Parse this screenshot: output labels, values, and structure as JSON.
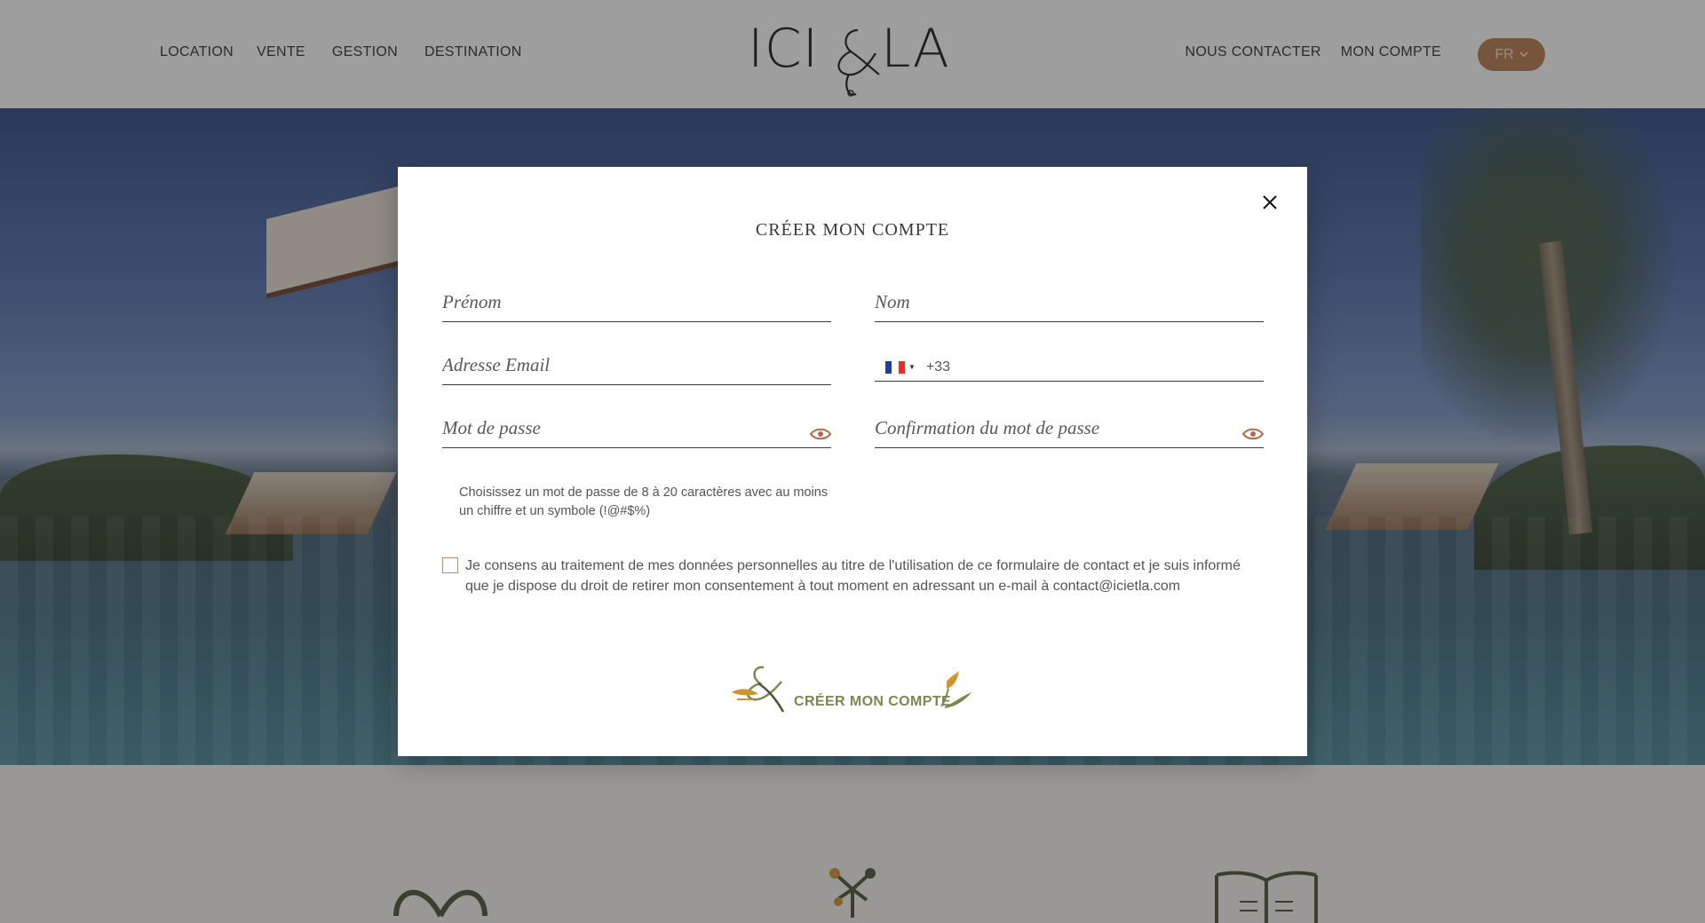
{
  "header": {
    "nav_left": [
      "LOCATION",
      "VENTE",
      "GESTION",
      "DESTINATION"
    ],
    "nav_right": [
      "NOUS CONTACTER",
      "MON COMPTE"
    ],
    "language": "FR",
    "logo_text": "ICI & LA"
  },
  "modal": {
    "title": "CRÉER MON COMPTE",
    "fields": {
      "first_name_placeholder": "Prénom",
      "last_name_placeholder": "Nom",
      "email_placeholder": "Adresse Email",
      "phone_country_code": "+33",
      "password_placeholder": "Mot de passe",
      "password_confirm_placeholder": "Confirmation du mot de passe"
    },
    "password_hint": "Choisissez un mot de passe de 8 à 20 caractères avec au moins un chiffre et un symbole (!@#$%)",
    "consent_text": "Je consens au traitement de mes données personnelles au titre de l'utilisation de ce formulaire de contact et je suis informé que je dispose du droit de retirer mon consentement à tout moment en adressant un e-mail à contact@icietla.com",
    "consent_checked": false,
    "submit_label": "CRÉER MON COMPTE"
  },
  "colors": {
    "accent": "#b87a4f",
    "submit_text": "#7c8850",
    "checkbox_border": "#c98a5c",
    "eye_icon": "#b56a48"
  },
  "icons": [
    "close-icon",
    "eye-icon",
    "france-flag-icon",
    "chevron-down-icon",
    "ampersand-logo-icon"
  ]
}
